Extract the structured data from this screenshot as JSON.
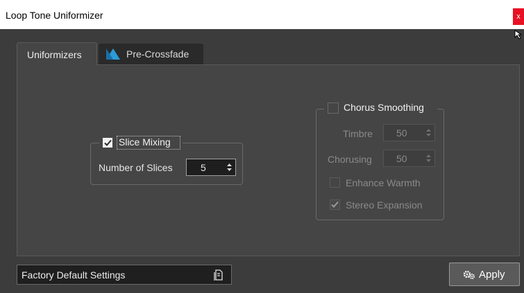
{
  "window": {
    "title": "Loop Tone Uniformizer",
    "close_label": "x"
  },
  "tabs": [
    {
      "label": "Uniformizers",
      "active": true
    },
    {
      "label": "Pre-Crossfade",
      "active": false,
      "icon": "crossfade-icon"
    }
  ],
  "slice_mixing": {
    "label": "Slice Mixing",
    "checked": true,
    "slices_label": "Number of Slices",
    "slices_value": "5"
  },
  "chorus": {
    "label": "Chorus Smoothing",
    "checked": false,
    "timbre_label": "Timbre",
    "timbre_value": "50",
    "chorusing_label": "Chorusing",
    "chorusing_value": "50",
    "warmth_label": "Enhance Warmth",
    "warmth_checked": false,
    "stereo_label": "Stereo Expansion",
    "stereo_checked": true
  },
  "footer": {
    "factory_label": "Factory Default Settings",
    "apply_label": "Apply"
  },
  "colors": {
    "accent": "#2a9bd8",
    "close": "#e81123",
    "panel": "#454545"
  }
}
